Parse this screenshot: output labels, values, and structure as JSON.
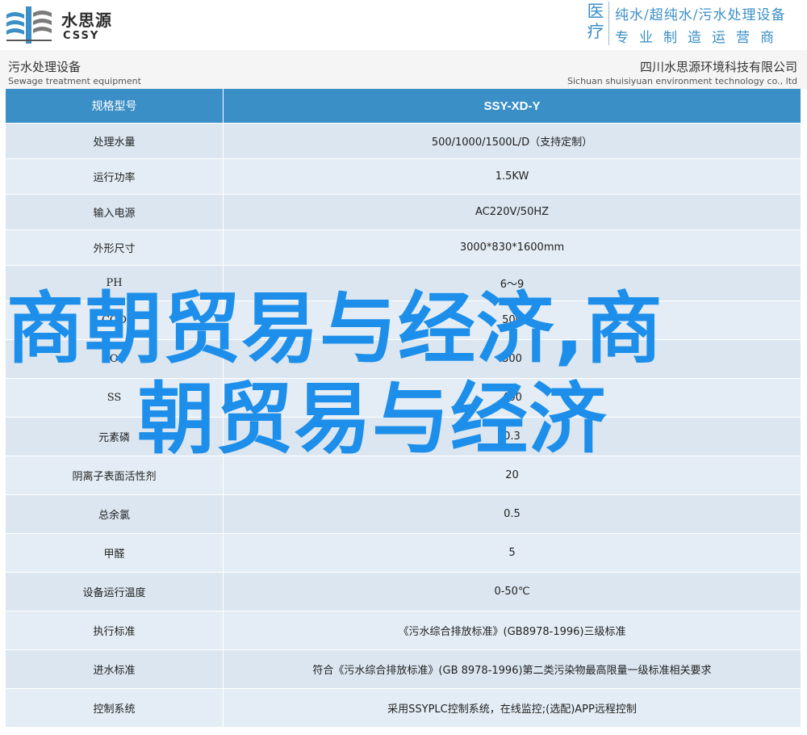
{
  "banner": {
    "logo_cn": "水思源",
    "logo_en": "CSSY",
    "badge_top": "医",
    "badge_bottom": "疗",
    "slogan_line1": "纯水/超纯水/污水处理设备",
    "slogan_line2": "专业制造运营商",
    "accent_color": "#3a8fc7"
  },
  "subheader": {
    "left_cn": "污水处理设备",
    "left_en": "Sewage treatment equipment",
    "right_cn": "四川水思源环境科技有限公司",
    "right_en": "Sichuan shuisiyuan environment technology co., ltd"
  },
  "table": {
    "header": {
      "key": "规格型号",
      "value": "SSY-XD-Y"
    },
    "rows": [
      {
        "key": "处理水量",
        "value": "500/1000/1500L/D（支持定制）"
      },
      {
        "key": "运行功率",
        "value": "1.5KW"
      },
      {
        "key": "输入电源",
        "value": "AC220V/50HZ"
      },
      {
        "key": "外形尺寸",
        "value": "3000*830*1600mm"
      },
      {
        "key": "PH",
        "value": "6～9"
      },
      {
        "key": "COD",
        "value": "500"
      },
      {
        "key": "BOD",
        "value": "300"
      },
      {
        "key": "SS",
        "value": "400"
      },
      {
        "key": "元素磷",
        "value": "0.3"
      },
      {
        "key": "阴离子表面活性剂",
        "value": "20"
      },
      {
        "key": "总余氯",
        "value": "0.5"
      },
      {
        "key": "甲醛",
        "value": "5"
      },
      {
        "key": "设备运行温度",
        "value": "0-50℃"
      },
      {
        "key": "执行标准",
        "value": "《污水综合排放标准》(GB8978-1996)三级标准"
      },
      {
        "key": "进水标准",
        "value": "符合《污水综合排放标准》(GB 8978-1996)第二类污染物最高限量一级标准相关要求"
      },
      {
        "key": "控制系统",
        "value": "采用SSYPLC控制系统，在线监控;(选配)APP远程控制"
      }
    ]
  },
  "overlay": {
    "line1": "商朝贸易与经济,商",
    "line2": "朝贸易与经济",
    "color": "#1d8fea"
  }
}
